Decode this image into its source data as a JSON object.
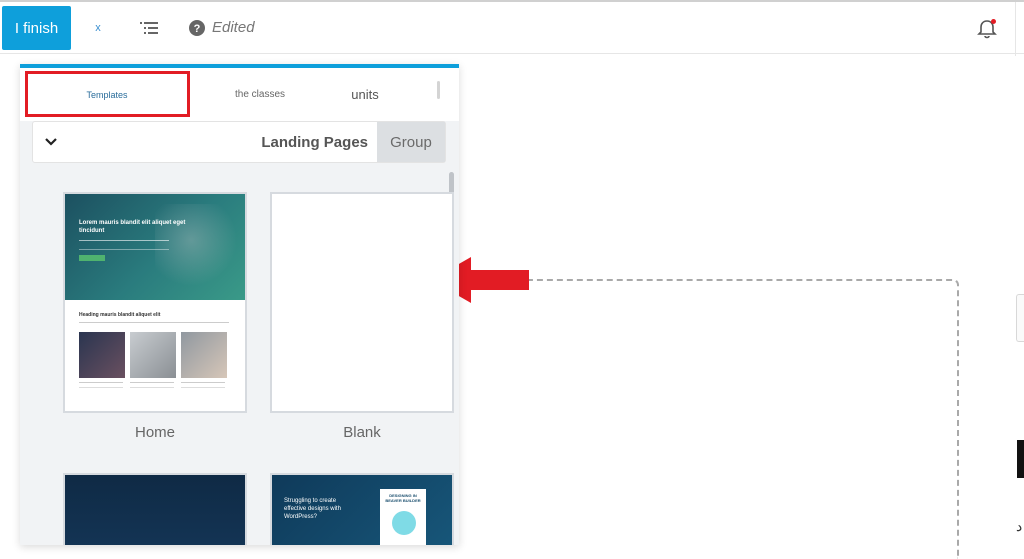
{
  "toolbar": {
    "finish_label": "I finish",
    "close_glyph": "x",
    "edited_label": "Edited",
    "accent_color": "#0e9fdb",
    "icons": [
      "close-icon",
      "outline-icon",
      "help-icon",
      "bell-icon"
    ]
  },
  "panel": {
    "tabs": [
      {
        "label": "Templates",
        "selected": true
      },
      {
        "label": "the classes",
        "selected": false
      },
      {
        "label": "units",
        "selected": false
      }
    ],
    "filter": {
      "category": "Landing Pages",
      "group_button": "Group"
    },
    "templates": [
      {
        "name": "Home"
      },
      {
        "name": "Blank"
      },
      {
        "name": ""
      },
      {
        "name": ""
      }
    ],
    "home_thumb": {
      "hero_title": "Lorem mauris blandit elit aliquet eget tincidunt",
      "section_title": "Heading mauris blandit aliquet elit"
    },
    "promo_thumb": {
      "text": "Struggling to create effective designs with WordPress?",
      "book_title": "DESIGNING IN BEAVER BUILDER"
    }
  },
  "annotation": {
    "highlight_color": "#e21c24"
  },
  "canvas": {
    "side_glyph": "د"
  }
}
